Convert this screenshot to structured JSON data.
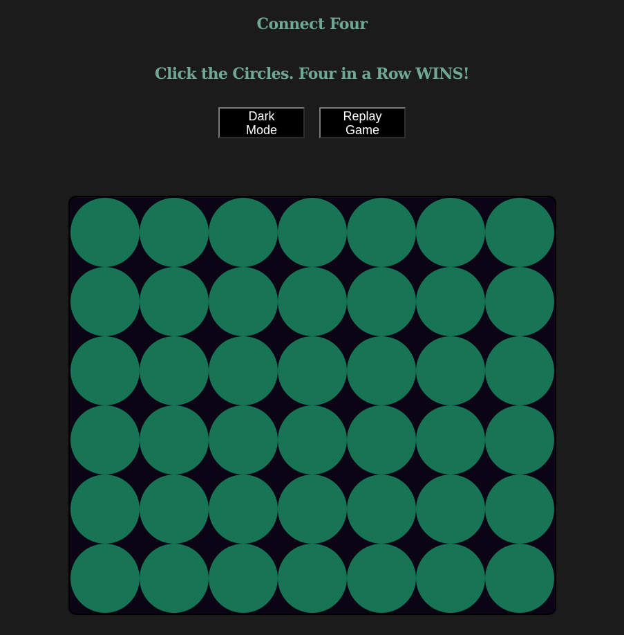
{
  "header": {
    "title": "Connect Four",
    "subtitle": "Click the Circles. Four in a Row WINS!"
  },
  "controls": {
    "dark_mode_label": "Dark Mode",
    "replay_label": "Replay Game"
  },
  "board": {
    "rows": 6,
    "columns": 7,
    "empty_color": "#177556",
    "background_color": "#0b0414",
    "cells": [
      [
        "empty",
        "empty",
        "empty",
        "empty",
        "empty",
        "empty",
        "empty"
      ],
      [
        "empty",
        "empty",
        "empty",
        "empty",
        "empty",
        "empty",
        "empty"
      ],
      [
        "empty",
        "empty",
        "empty",
        "empty",
        "empty",
        "empty",
        "empty"
      ],
      [
        "empty",
        "empty",
        "empty",
        "empty",
        "empty",
        "empty",
        "empty"
      ],
      [
        "empty",
        "empty",
        "empty",
        "empty",
        "empty",
        "empty",
        "empty"
      ],
      [
        "empty",
        "empty",
        "empty",
        "empty",
        "empty",
        "empty",
        "empty"
      ]
    ]
  },
  "colors": {
    "page_background": "#1b1b1b",
    "heading_text": "#6fa896",
    "button_background": "#000000",
    "button_text": "#ffffff"
  }
}
